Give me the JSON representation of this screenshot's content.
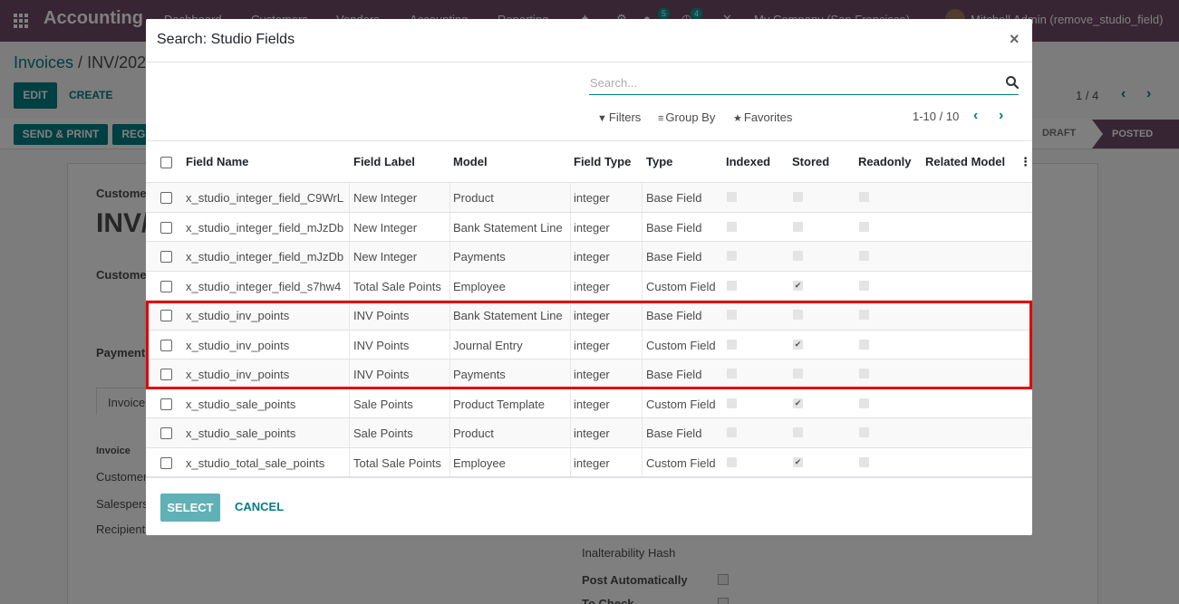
{
  "app": {
    "title": "Accounting",
    "menu": [
      "Dashboard",
      "Customers",
      "Vendors",
      "Accounting",
      "Reporting"
    ],
    "chat_badge": "5",
    "activity_badge": "4",
    "company": "My Company (San Francisco)",
    "user": "Mitchell Admin (remove_studio_field)"
  },
  "breadcrumb": {
    "parent": "Invoices",
    "sep": " / ",
    "current": "INV/202"
  },
  "form_buttons": {
    "edit": "EDIT",
    "create": "CREATE"
  },
  "record_pager": {
    "value": "1 / 4",
    "prev": "‹",
    "next": "›"
  },
  "action_buttons": {
    "send_print": "SEND & PRINT",
    "register": "REGI"
  },
  "statusbar": {
    "draft": "DRAFT",
    "posted": "POSTED"
  },
  "form_bg": {
    "customer_label": "Customer",
    "big_title": "INV/",
    "customer2_label": "Customer",
    "payment_label": "Payment",
    "tab_invoice": "Invoice",
    "section_invoice": "Invoice",
    "field_customer": "Customer",
    "field_salesperson": "Salespers",
    "field_recipient": "Recipient",
    "inalterability": "Inalterability Hash",
    "post_auto": "Post Automatically",
    "to_check": "To Check"
  },
  "dialog": {
    "title": "Search: Studio Fields",
    "close": "×",
    "search": {
      "placeholder": "Search...",
      "value": ""
    },
    "filters_label": "Filters",
    "groupby_label": "Group By",
    "favorites_label": "Favorites",
    "pager": "1-10 / 10",
    "columns": [
      "Field Name",
      "Field Label",
      "Model",
      "Field Type",
      "Type",
      "Indexed",
      "Stored",
      "Readonly",
      "Related Model"
    ],
    "rows": [
      {
        "name": "x_studio_integer_field_C9WrL",
        "label": "New Integer",
        "model": "Product",
        "ftype": "integer",
        "type": "Base Field",
        "indexed": false,
        "stored": false,
        "readonly": false,
        "related": ""
      },
      {
        "name": "x_studio_integer_field_mJzDb",
        "label": "New Integer",
        "model": "Bank Statement Line",
        "ftype": "integer",
        "type": "Base Field",
        "indexed": false,
        "stored": false,
        "readonly": false,
        "related": ""
      },
      {
        "name": "x_studio_integer_field_mJzDb",
        "label": "New Integer",
        "model": "Payments",
        "ftype": "integer",
        "type": "Base Field",
        "indexed": false,
        "stored": false,
        "readonly": false,
        "related": ""
      },
      {
        "name": "x_studio_integer_field_s7hw4",
        "label": "Total Sale Points",
        "model": "Employee",
        "ftype": "integer",
        "type": "Custom Field",
        "indexed": false,
        "stored": true,
        "readonly": false,
        "related": ""
      },
      {
        "name": "x_studio_inv_points",
        "label": "INV Points",
        "model": "Bank Statement Line",
        "ftype": "integer",
        "type": "Base Field",
        "indexed": false,
        "stored": false,
        "readonly": false,
        "related": ""
      },
      {
        "name": "x_studio_inv_points",
        "label": "INV Points",
        "model": "Journal Entry",
        "ftype": "integer",
        "type": "Custom Field",
        "indexed": false,
        "stored": true,
        "readonly": false,
        "related": ""
      },
      {
        "name": "x_studio_inv_points",
        "label": "INV Points",
        "model": "Payments",
        "ftype": "integer",
        "type": "Base Field",
        "indexed": false,
        "stored": false,
        "readonly": false,
        "related": ""
      },
      {
        "name": "x_studio_sale_points",
        "label": "Sale Points",
        "model": "Product Template",
        "ftype": "integer",
        "type": "Custom Field",
        "indexed": false,
        "stored": true,
        "readonly": false,
        "related": ""
      },
      {
        "name": "x_studio_sale_points",
        "label": "Sale Points",
        "model": "Product",
        "ftype": "integer",
        "type": "Base Field",
        "indexed": false,
        "stored": false,
        "readonly": false,
        "related": ""
      },
      {
        "name": "x_studio_total_sale_points",
        "label": "Total Sale Points",
        "model": "Employee",
        "ftype": "integer",
        "type": "Custom Field",
        "indexed": false,
        "stored": true,
        "readonly": false,
        "related": ""
      }
    ],
    "select_label": "SELECT",
    "cancel_label": "CANCEL"
  },
  "colors": {
    "brand": "#714B67",
    "accent": "#017e84",
    "highlight": "#e00000"
  }
}
